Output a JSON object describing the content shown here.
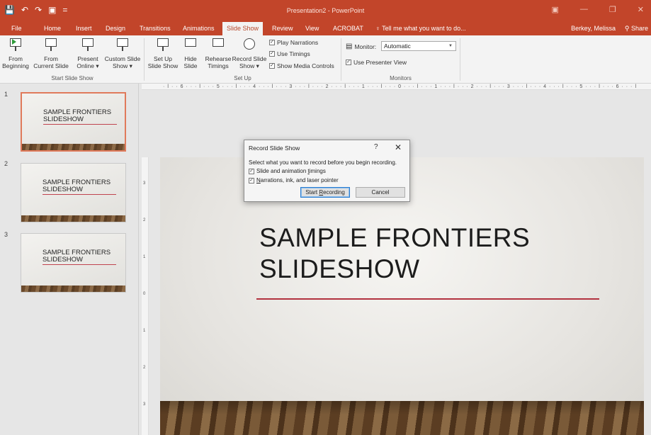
{
  "window": {
    "title": "Presentation2 - PowerPoint",
    "qat": [
      "💾",
      "↶",
      "↷",
      "▣",
      "="
    ],
    "controls": [
      "▣",
      "—",
      "❐",
      "✕"
    ]
  },
  "tabs": [
    "File",
    "Home",
    "Insert",
    "Design",
    "Transitions",
    "Animations",
    "Slide Show",
    "Review",
    "View",
    "ACROBAT"
  ],
  "active_tab": "Slide Show",
  "tell_me": "Tell me what you want to do...",
  "user": "Berkey, Melissa",
  "share": "Share",
  "ribbon": {
    "start_group": {
      "label": "Start Slide Show",
      "buttons": [
        {
          "line1": "From",
          "line2": "Beginning"
        },
        {
          "line1": "From",
          "line2": "Current Slide"
        },
        {
          "line1": "Present",
          "line2": "Online ▾"
        },
        {
          "line1": "Custom Slide",
          "line2": "Show ▾"
        }
      ]
    },
    "setup_group": {
      "label": "Set Up",
      "buttons": [
        {
          "line1": "Set Up",
          "line2": "Slide Show"
        },
        {
          "line1": "Hide",
          "line2": "Slide"
        },
        {
          "line1": "Rehearse",
          "line2": "Timings"
        },
        {
          "line1": "Record Slide",
          "line2": "Show ▾"
        }
      ],
      "checks": [
        {
          "label": "Play Narrations",
          "checked": true
        },
        {
          "label": "Use Timings",
          "checked": true
        },
        {
          "label": "Show Media Controls",
          "checked": true
        }
      ]
    },
    "monitors_group": {
      "label": "Monitors",
      "monitor_label": "Monitor:",
      "monitor_value": "Automatic",
      "presenter_view": "Use Presenter View",
      "presenter_checked": true
    }
  },
  "ruler_top": "· ǀ · · 6 · · · ǀ · · · 5 · · · ǀ · · · 4 · · · ǀ · · · 3 · · · ǀ · · · 2 · · · ǀ · · · 1 · · · ǀ · · · 0 · · · ǀ · · · 1 · · · ǀ · · · 2 · · · ǀ · · · 3 · · · ǀ · · · 4 · · · ǀ · · · 5 · · · ǀ · · · 6 · · · ǀ",
  "ruler_left": [
    "3",
    "2",
    "1",
    "0",
    "1",
    "2",
    "3"
  ],
  "slides": [
    {
      "number": "1",
      "title": "SAMPLE FRONTIERS\nSLIDESHOW",
      "selected": true
    },
    {
      "number": "2",
      "title": "SAMPLE FRONTIERS\nSLIDESHOW",
      "selected": false
    },
    {
      "number": "3",
      "title": "SAMPLE FRONTIERS\nSLIDESHOW",
      "selected": false
    }
  ],
  "current_slide": {
    "title": "SAMPLE FRONTIERS\nSLIDESHOW"
  },
  "dialog": {
    "title": "Record Slide Show",
    "help": "?",
    "close": "✕",
    "instruction": "Select what you want to record before you begin recording.",
    "option1_pre": "Slide and animation ",
    "option1_u": "t",
    "option1_post": "imings",
    "option2_u": "N",
    "option2_post": "arrations, ink, and laser pointer",
    "start_pre": "Start ",
    "start_u": "R",
    "start_post": "ecording",
    "cancel": "Cancel"
  },
  "colors": {
    "accent": "#c2452a",
    "slide_line": "#b2323f"
  }
}
